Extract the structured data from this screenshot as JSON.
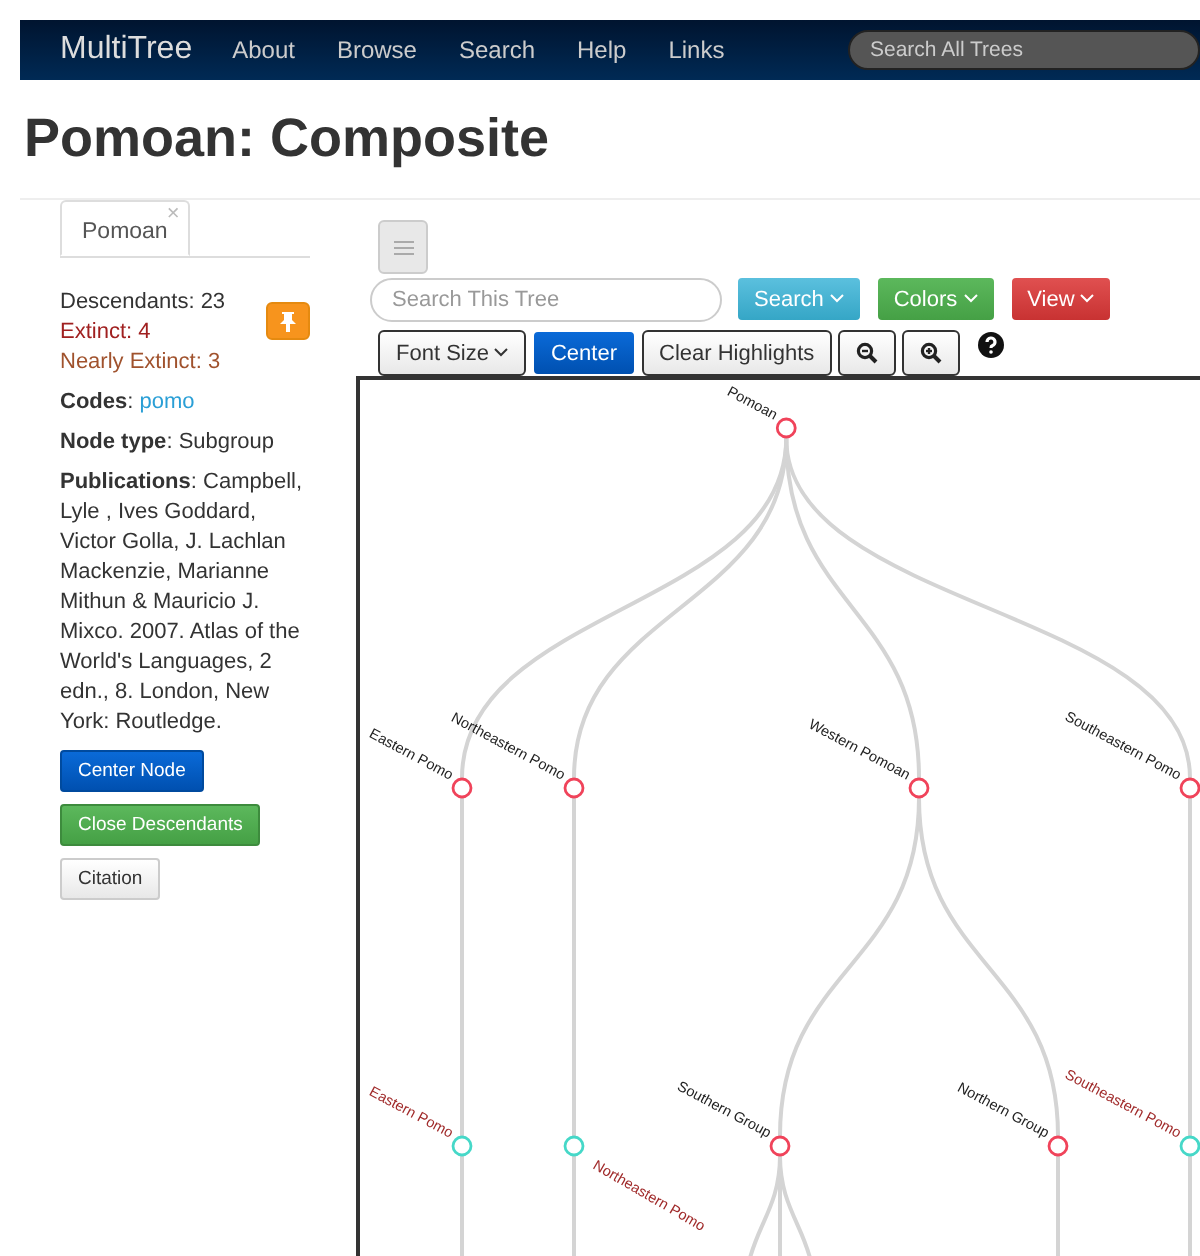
{
  "navbar": {
    "brand": "MultiTree",
    "links": [
      "About",
      "Browse",
      "Search",
      "Help",
      "Links"
    ],
    "search": {
      "placeholder": "Search All Trees"
    }
  },
  "page_title": "Pomoan: Composite",
  "sidebar": {
    "tabs": [
      {
        "label": "Pomoan",
        "close": "×",
        "selected": true
      }
    ],
    "stats": [
      {
        "text": "Descendants: 23",
        "kind": "total"
      },
      {
        "text": "Extinct: 4",
        "kind": "extinct"
      },
      {
        "text": "Nearly Extinct: 3",
        "kind": "nearly_extinct"
      }
    ],
    "fields": [
      {
        "label": "**Codes**:",
        "value": "pomo",
        "kind": "link"
      },
      {
        "label": "**Node type**:",
        "value": "Subgroup",
        "kind": "text"
      },
      {
        "label": "**Publications**:",
        "value": "Campbell, Lyle , Ives Goddard, Victor Golla, J. Lachlan Mackenzie, Marianne Mithun & Mauricio J. Mixco. 2007. Atlas of the World's Languages, 2 edn., 8. London, New York: Routledge.",
        "kind": "text"
      }
    ],
    "buttons": [
      {
        "label": "Center Node",
        "kind": "primary"
      },
      {
        "label": "Close Descendants",
        "kind": "success"
      },
      {
        "label": "Citation",
        "kind": "default"
      }
    ]
  },
  "toolbar": {
    "search": {
      "placeholder": "Search This Tree"
    },
    "dropdowns": [
      {
        "label": "Search",
        "kind": "info"
      },
      {
        "label": "Colors",
        "kind": "success"
      },
      {
        "label": "View",
        "kind": "danger"
      }
    ],
    "buttons": [
      {
        "label": "Font Size",
        "kind": "dropdown"
      },
      {
        "label": "Center",
        "kind": "primary"
      },
      {
        "label": "Clear Highlights",
        "kind": "default"
      },
      {
        "kind": "zoom_out"
      },
      {
        "kind": "zoom_in"
      },
      {
        "kind": "help"
      }
    ]
  },
  "tree": {
    "name": "Pomoan",
    "kind": "group",
    "children": [
      {
        "name": "Eastern Pomo",
        "kind": "group",
        "children": [
          {
            "name": "Eastern Pomo",
            "kind": "language"
          }
        ]
      },
      {
        "name": "Northeastern Pomo",
        "kind": "group",
        "children": [
          {
            "name": "Northeastern Pomo",
            "kind": "language"
          }
        ]
      },
      {
        "name": "Western Pomoan",
        "kind": "group",
        "children": [
          {
            "name": "Southern Group",
            "kind": "group"
          },
          {
            "name": "Northern Group",
            "kind": "group"
          }
        ]
      },
      {
        "name": "Southeastern Pomo",
        "kind": "group",
        "children": [
          {
            "name": "Southeastern Pomo",
            "kind": "language"
          }
        ]
      }
    ]
  }
}
